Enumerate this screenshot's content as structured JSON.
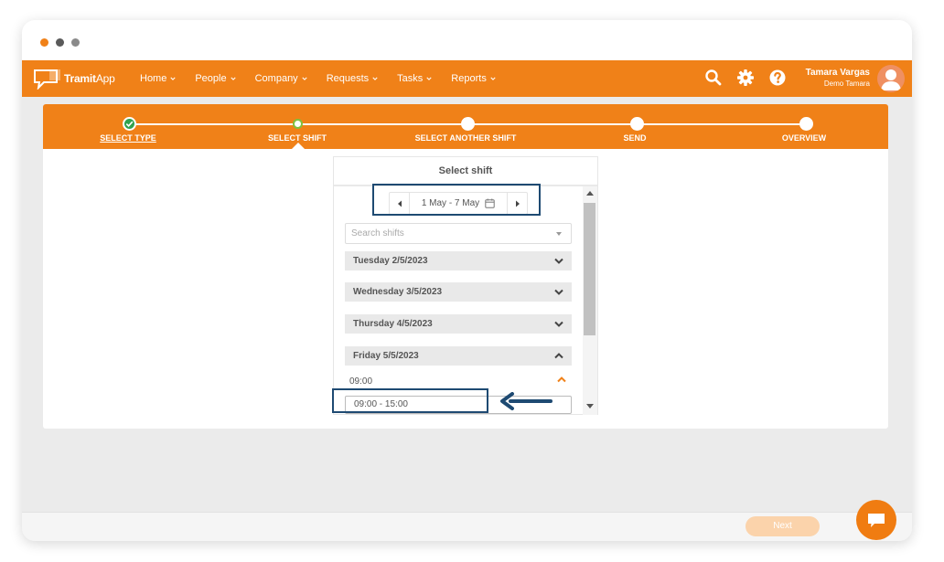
{
  "nav": {
    "logo_brand": "Tramit",
    "logo_app": "App",
    "menu": [
      {
        "label": "Home"
      },
      {
        "label": "People"
      },
      {
        "label": "Company"
      },
      {
        "label": "Requests"
      },
      {
        "label": "Tasks"
      },
      {
        "label": "Reports"
      }
    ],
    "user_name": "Tamara Vargas",
    "user_org": "Demo Tamara"
  },
  "stepper": {
    "steps": [
      {
        "label": "SELECT TYPE",
        "state": "done"
      },
      {
        "label": "SELECT SHIFT",
        "state": "active"
      },
      {
        "label": "SELECT ANOTHER SHIFT",
        "state": "pending"
      },
      {
        "label": "SEND",
        "state": "pending"
      },
      {
        "label": "OVERVIEW",
        "state": "pending"
      }
    ]
  },
  "panel": {
    "title": "Select shift",
    "week_range": "1 May - 7 May",
    "search_placeholder": "Search shifts",
    "days": [
      {
        "label": "Tuesday 2/5/2023",
        "expanded": false
      },
      {
        "label": "Wednesday 3/5/2023",
        "expanded": false
      },
      {
        "label": "Thursday 4/5/2023",
        "expanded": false
      },
      {
        "label": "Friday 5/5/2023",
        "expanded": true
      }
    ],
    "shift_time": "09:00",
    "shift_option": "09:00 - 15:00"
  },
  "footer": {
    "next_label": "Next"
  },
  "colors": {
    "brand_orange": "#f08118",
    "step_done_green": "#2fa24f",
    "highlight_navy": "#1e4a72",
    "next_disabled": "#fbd3ab"
  }
}
